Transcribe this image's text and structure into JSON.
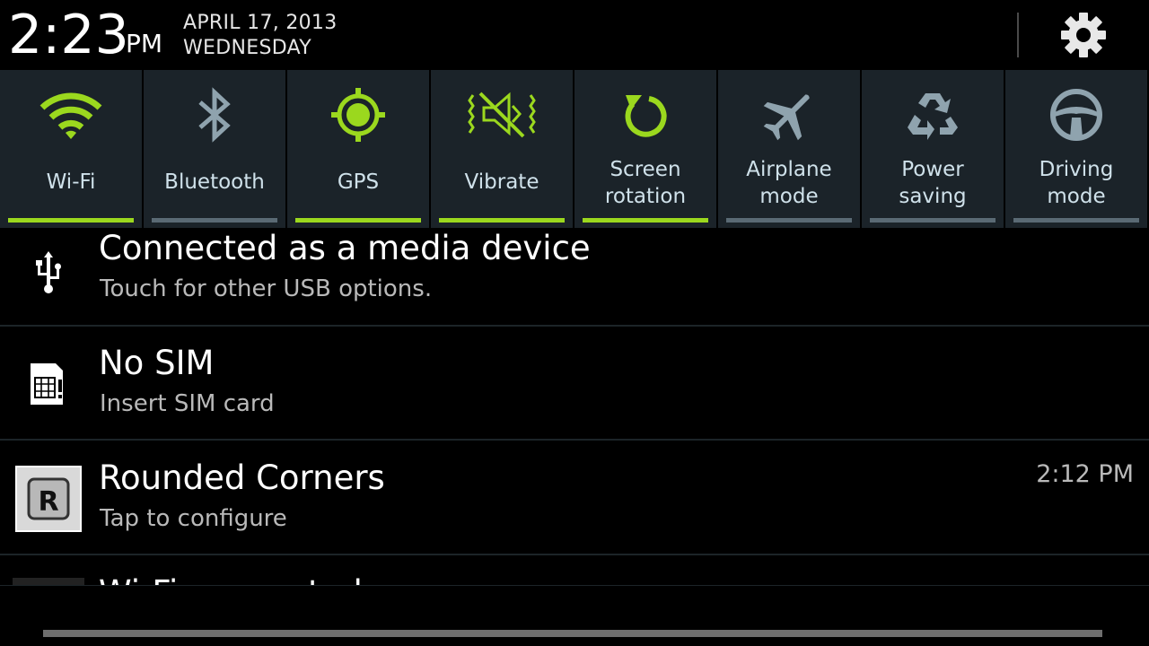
{
  "status": {
    "time": "2:23",
    "ampm": "PM",
    "date": "APRIL 17, 2013",
    "weekday": "WEDNESDAY",
    "settings_icon": "gear-icon"
  },
  "colors": {
    "accent_on": "#9bd81e",
    "icon_off": "#8fa3ae",
    "tile_bg": "#1b2329"
  },
  "quick_settings": [
    {
      "label": "Wi-Fi",
      "icon": "wifi-icon",
      "active": true
    },
    {
      "label": "Bluetooth",
      "icon": "bluetooth-icon",
      "active": false
    },
    {
      "label": "GPS",
      "icon": "gps-icon",
      "active": true
    },
    {
      "label": "Vibrate",
      "icon": "vibrate-icon",
      "active": true
    },
    {
      "label_line1": "Screen",
      "label_line2": "rotation",
      "icon": "rotation-icon",
      "active": true
    },
    {
      "label_line1": "Airplane",
      "label_line2": "mode",
      "icon": "airplane-icon",
      "active": false
    },
    {
      "label_line1": "Power",
      "label_line2": "saving",
      "icon": "recycle-icon",
      "active": false
    },
    {
      "label_line1": "Driving",
      "label_line2": "mode",
      "icon": "steering-wheel-icon",
      "active": false
    }
  ],
  "notifications": [
    {
      "title": "Connected as a media device",
      "subtitle": "Touch for other USB options.",
      "icon": "usb-icon"
    },
    {
      "title": "No SIM",
      "subtitle": "Insert SIM card",
      "icon": "sim-card-icon"
    },
    {
      "title": "Rounded Corners",
      "subtitle": "Tap to configure",
      "time": "2:12 PM",
      "icon": "rounded-corners-app-icon",
      "icon_letter": "R"
    },
    {
      "title": "Wi-Fi connected",
      "icon": "wifi-notification-icon"
    }
  ]
}
